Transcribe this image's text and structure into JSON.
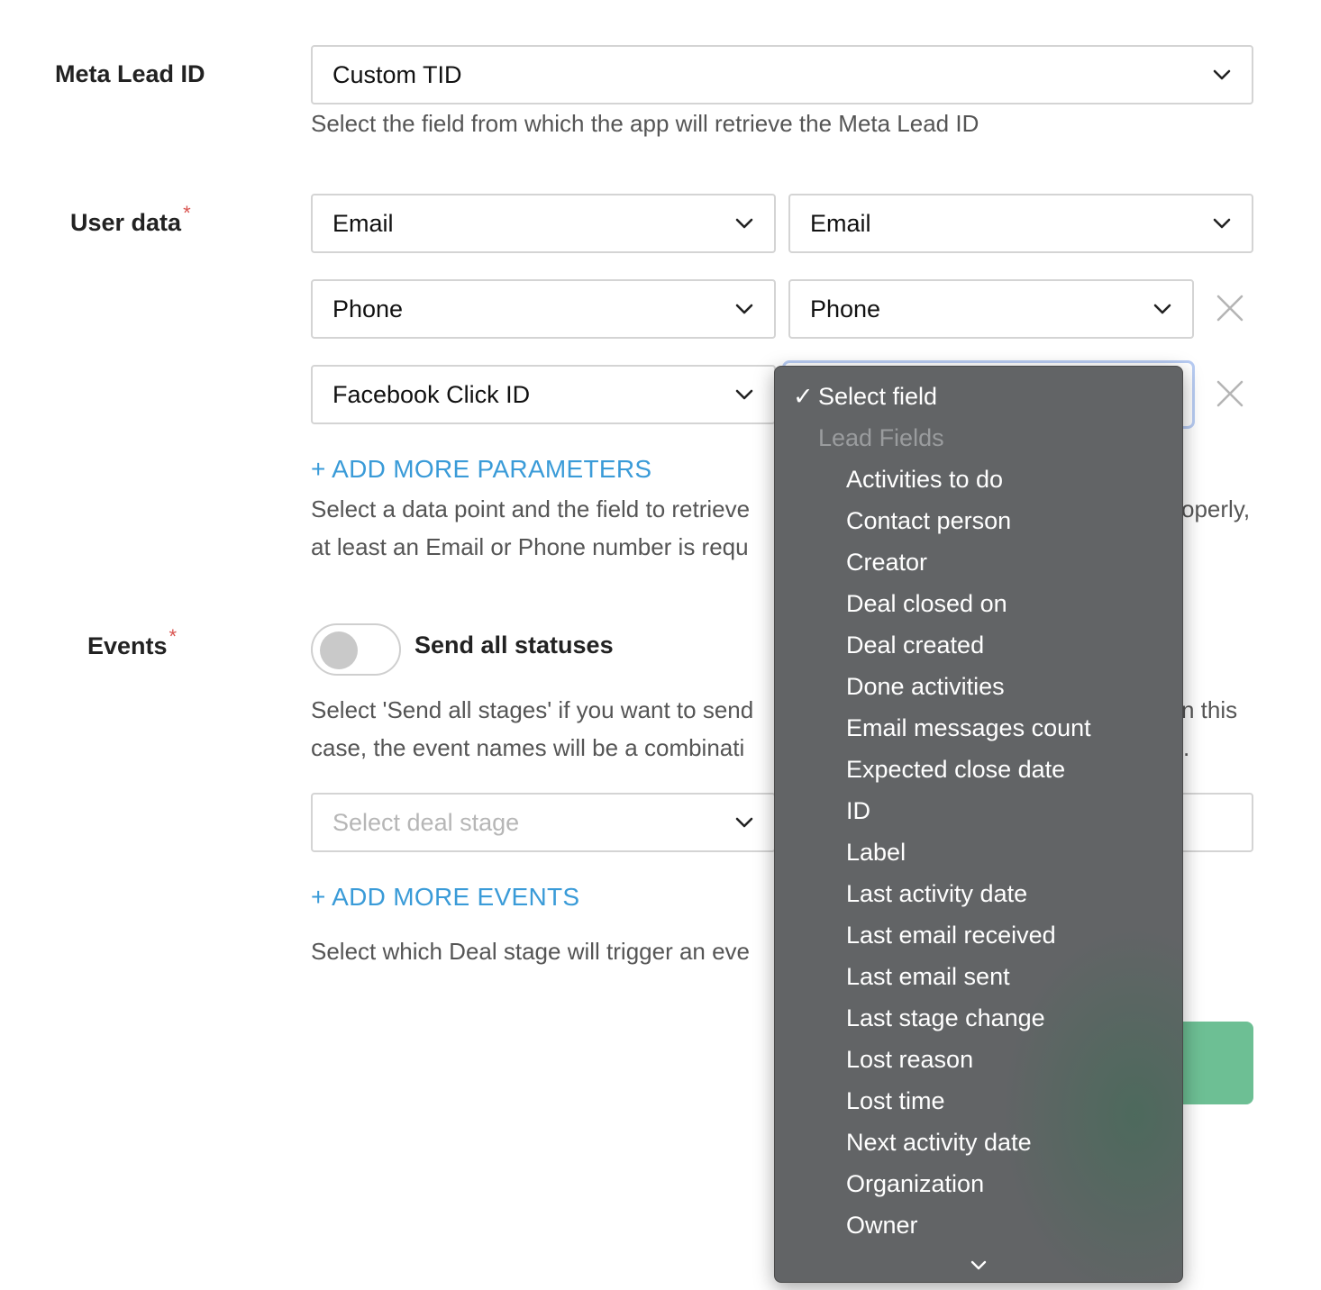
{
  "meta_lead": {
    "label": "Meta Lead ID",
    "select_value": "Custom TID",
    "help": "Select the field from which the app will retrieve the Meta Lead ID"
  },
  "user_data": {
    "label": "User data",
    "required_mark": "*",
    "rows": [
      {
        "param": "Email",
        "field": "Email"
      },
      {
        "param": "Phone",
        "field": "Phone"
      },
      {
        "param": "Facebook Click ID",
        "field": ""
      }
    ],
    "add_more": "+ ADD MORE PARAMETERS",
    "help_line1_left": "Select a data point and the field to retrieve",
    "help_line1_right": "operly,",
    "help_line2_left": "at least an Email or Phone number is requ"
  },
  "events": {
    "label": "Events",
    "required_mark": "*",
    "toggle_label": "Send all statuses",
    "toggle_on": false,
    "help_line1_left": "Select 'Send all stages' if you want to send",
    "help_line1_right": "n this",
    "help_line2_left": "case, the event names will be a combinati",
    "help_line2_right": ".",
    "stage_placeholder": "Select deal stage",
    "add_more": "+ ADD MORE EVENTS",
    "help_bottom": "Select which Deal stage will trigger an eve"
  },
  "dropdown": {
    "selected": "Select field",
    "checkmark": "✓",
    "group": "Lead Fields",
    "options": [
      "Activities to do",
      "Contact person",
      "Creator",
      "Deal closed on",
      "Deal created",
      "Done activities",
      "Email messages count",
      "Expected close date",
      "ID",
      "Label",
      "Last activity date",
      "Last email received",
      "Last email sent",
      "Last stage change",
      "Lost reason",
      "Lost time",
      "Next activity date",
      "Organization",
      "Owner"
    ]
  },
  "colors": {
    "link": "#3a9bd8",
    "required": "#d9534f",
    "submit": "#6dbf94",
    "dropdown_bg": "#626466"
  }
}
